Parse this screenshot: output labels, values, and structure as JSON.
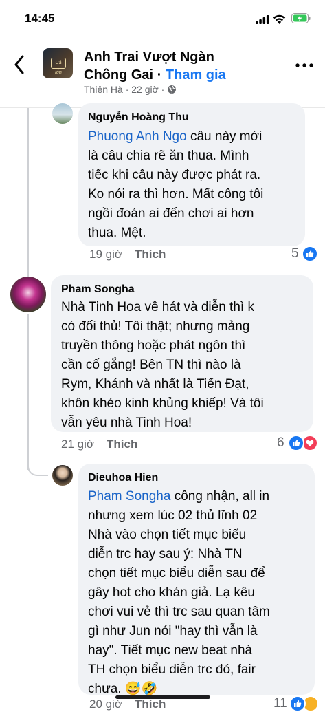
{
  "status": {
    "time": "14:45"
  },
  "header": {
    "title_line1": "Anh Trai Vượt Ngàn",
    "title_line2": "Chông Gai",
    "separator": " · ",
    "join": "Tham gia",
    "source": "Thiên Hà · 22 giờ ·",
    "avatar_logo": "Cá lớn"
  },
  "comments": [
    {
      "author": "Nguyễn Hoàng Thu",
      "mention": "Phuong Anh Ngo",
      "lines": [
        "câu này mới",
        "là câu chia rẽ ăn thua. Mình",
        "tiếc khi câu này được phát ra.",
        "Ko nói ra thì hơn. Mất công tôi",
        "ngồi đoán ai đến chơi ai hơn",
        "thua. Mệt."
      ],
      "time": "19 giờ",
      "like_label": "Thích",
      "reaction_count": "5",
      "reactions": [
        "like-icon"
      ]
    },
    {
      "author": "Pham Songha",
      "lines": [
        "Nhà Tinh Hoa về hát và diễn thì k",
        "có đối thủ! Tôi thật; nhưng mảng",
        "truyền thông hoặc phát ngôn thì",
        "cần cố gắng! Bên TN thì nào là",
        "Rym, Khánh và nhất là Tiến Đạt,",
        "khôn khéo kinh khủng khiếp! Và tôi",
        "vẫn yêu nhà Tinh Hoa!"
      ],
      "time": "21 giờ",
      "like_label": "Thích",
      "reaction_count": "6",
      "reactions": [
        "like-icon",
        "love-icon"
      ]
    },
    {
      "author": "Dieuhoa Hien",
      "mention": "Pham Songha",
      "lines": [
        "công nhận, all in",
        "nhưng xem lúc 02 thủ lĩnh 02",
        "Nhà vào chọn tiết mục biểu",
        "diễn trc hay sau ý: Nhà TN",
        "chọn tiết mục biểu diễn sau để",
        "gây hot cho khán giả. Lạ kêu",
        "chơi vui vẻ thì trc sau quan tâm",
        "gì như Jun nói \"hay thì vẫn là",
        "hay\". Tiết mục new beat nhà",
        "TH chọn biểu diễn trc đó, fair",
        "chưa. 😅🤣"
      ],
      "time": "20 giờ",
      "like_label": "Thích",
      "reaction_count": "11",
      "reactions": [
        "like-icon",
        "haha-icon"
      ]
    }
  ]
}
